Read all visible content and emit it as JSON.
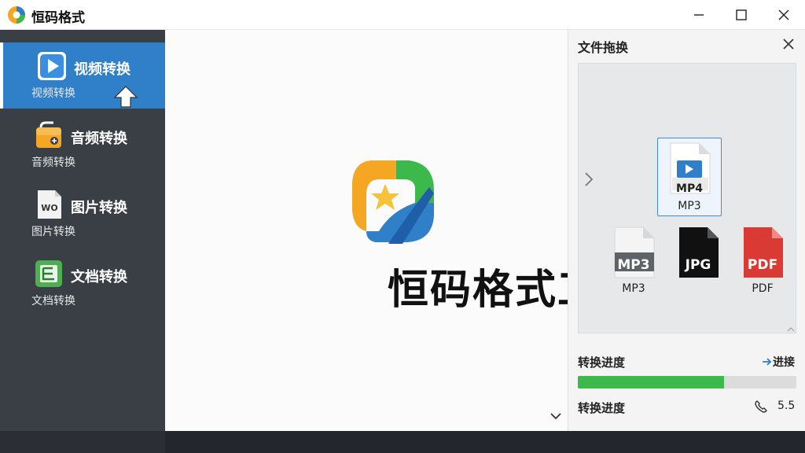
{
  "window": {
    "title": "恒码格式"
  },
  "sidebar": {
    "items": [
      {
        "label": "视频转换",
        "sub": "视频转换",
        "active": true,
        "icon": "play-icon"
      },
      {
        "label": "音频转换",
        "sub": "音频转换",
        "active": false,
        "icon": "audio-icon"
      },
      {
        "label": "图片转换",
        "sub": "图片转换",
        "active": false,
        "icon": "image-file-icon"
      },
      {
        "label": "文档转换",
        "sub": "文档转换",
        "active": false,
        "icon": "document-icon"
      }
    ]
  },
  "main": {
    "brand_text": "恒码格式工厂"
  },
  "panel": {
    "title": "文件拖换",
    "files": {
      "selected": {
        "badge": "MP4",
        "caption": "MP3"
      },
      "items": [
        {
          "badge": "MP3",
          "caption": "MP3",
          "color": "#5f6368"
        },
        {
          "badge": "JPG",
          "caption": "",
          "color": "#111111"
        },
        {
          "badge": "PDF",
          "caption": "PDF",
          "color": "#d93a33"
        }
      ]
    },
    "progress": {
      "label": "转换进度",
      "link_label": "进接",
      "percent": 67,
      "label2": "转换进度",
      "rate": "5.5"
    }
  },
  "colors": {
    "sidebar_bg": "#3a3f46",
    "active_item": "#2f7fc9",
    "progress_fill": "#3cb94a"
  }
}
